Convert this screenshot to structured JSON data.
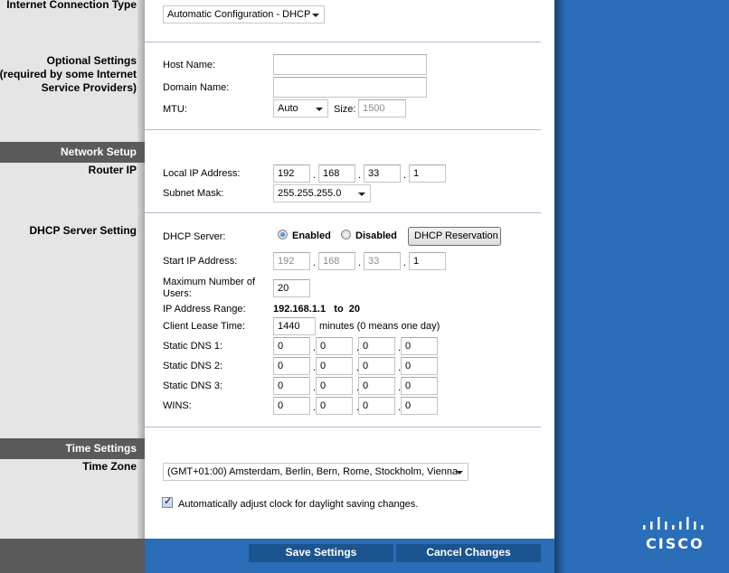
{
  "sidebar": {
    "internet_connection_type": "Internet Connection Type",
    "optional_settings": [
      "Optional Settings",
      "(required by some Internet",
      "Service Providers)"
    ],
    "network_setup": "Network Setup",
    "router_ip": "Router IP",
    "dhcp_server_setting": "DHCP Server Setting",
    "time_settings": "Time Settings",
    "time_zone": "Time Zone"
  },
  "internet": {
    "connection_type": "Automatic Configuration - DHCP"
  },
  "optional": {
    "host_name_label": "Host Name:",
    "host_name": "",
    "domain_name_label": "Domain Name:",
    "domain_name": "",
    "mtu_label": "MTU:",
    "mtu_mode": "Auto",
    "size_label": "Size:",
    "size_value": "1500"
  },
  "router": {
    "local_ip_label": "Local IP Address:",
    "local_ip": [
      "192",
      "168",
      "33",
      "1"
    ],
    "subnet_label": "Subnet Mask:",
    "subnet_mask": "255.255.255.0"
  },
  "dhcp": {
    "server_label": "DHCP Server:",
    "enabled_label": "Enabled",
    "disabled_label": "Disabled",
    "selected": "Enabled",
    "reservation_button": "DHCP Reservation",
    "start_ip_label": "Start IP Address:",
    "start_ip": [
      "192",
      "168",
      "33",
      "1"
    ],
    "max_users_label_1": "Maximum Number of",
    "max_users_label_2": "Users:",
    "max_users": "20",
    "range_label": "IP Address Range:",
    "range_value": "192.168.1.1   to  20",
    "lease_label": "Client Lease Time:",
    "lease_value": "1440",
    "lease_hint": "minutes (0 means one day)",
    "dns1_label": "Static DNS 1:",
    "dns1": [
      "0",
      "0",
      "0",
      "0"
    ],
    "dns2_label": "Static DNS 2:",
    "dns2": [
      "0",
      "0",
      "0",
      "0"
    ],
    "dns3_label": "Static DNS 3:",
    "dns3": [
      "0",
      "0",
      "0",
      "0"
    ],
    "wins_label": "WINS:",
    "wins": [
      "0",
      "0",
      "0",
      "0"
    ]
  },
  "time": {
    "time_zone": "(GMT+01:00) Amsterdam, Berlin, Bern, Rome, Stockholm, Vienna",
    "dst_checked": true,
    "dst_label": "Automatically adjust clock for daylight saving changes."
  },
  "actions": {
    "save": "Save Settings",
    "cancel": "Cancel Changes"
  },
  "brand": {
    "logo_text": "CISCO",
    "accent_color": "#2a6eb8"
  }
}
